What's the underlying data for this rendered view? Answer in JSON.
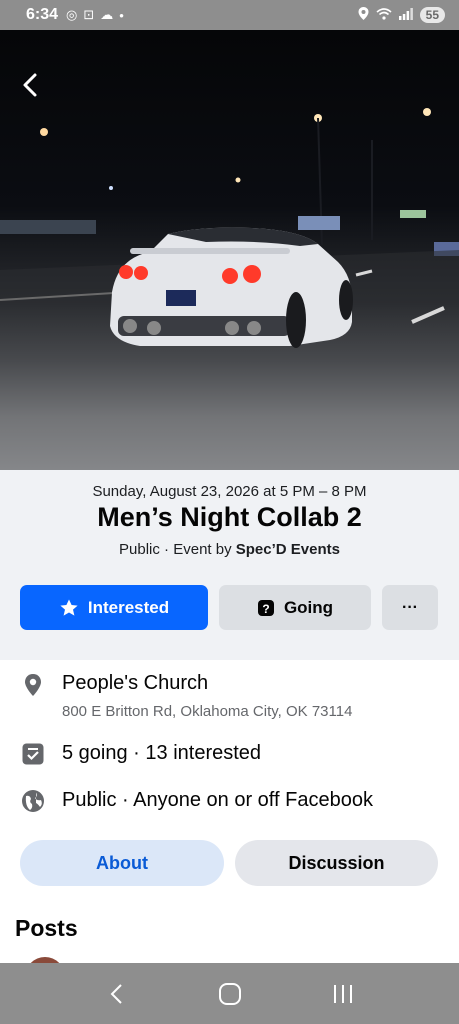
{
  "status_bar": {
    "time": "6:34",
    "battery": "55"
  },
  "event": {
    "date": "Sunday, August 23, 2026 at 5 PM – 8 PM",
    "title": "Men’s Night Collab 2",
    "privacy_prefix": "Public · Event by ",
    "organizer": "Spec’D Events"
  },
  "actions": {
    "interested_label": "Interested",
    "going_label": "Going",
    "more_label": "···"
  },
  "info": {
    "location_name": "People's Church",
    "location_address": "800 E Britton Rd, Oklahoma City, OK 73114",
    "attendance": "5 going · 13 interested",
    "visibility": "Public · Anyone on or off Facebook"
  },
  "tabs": {
    "about": "About",
    "discussion": "Discussion"
  },
  "posts": {
    "heading": "Posts"
  },
  "colors": {
    "accent": "#0866ff",
    "secondary_button": "#dcdfe3",
    "tab_active_bg": "#dbe7f8",
    "system_bar": "#8e8e8e"
  },
  "icons": {
    "back": "chevron-left-icon",
    "interested": "star-icon",
    "going": "question-icon",
    "location": "map-pin-icon",
    "attendance": "checklist-icon",
    "visibility": "globe-icon"
  }
}
